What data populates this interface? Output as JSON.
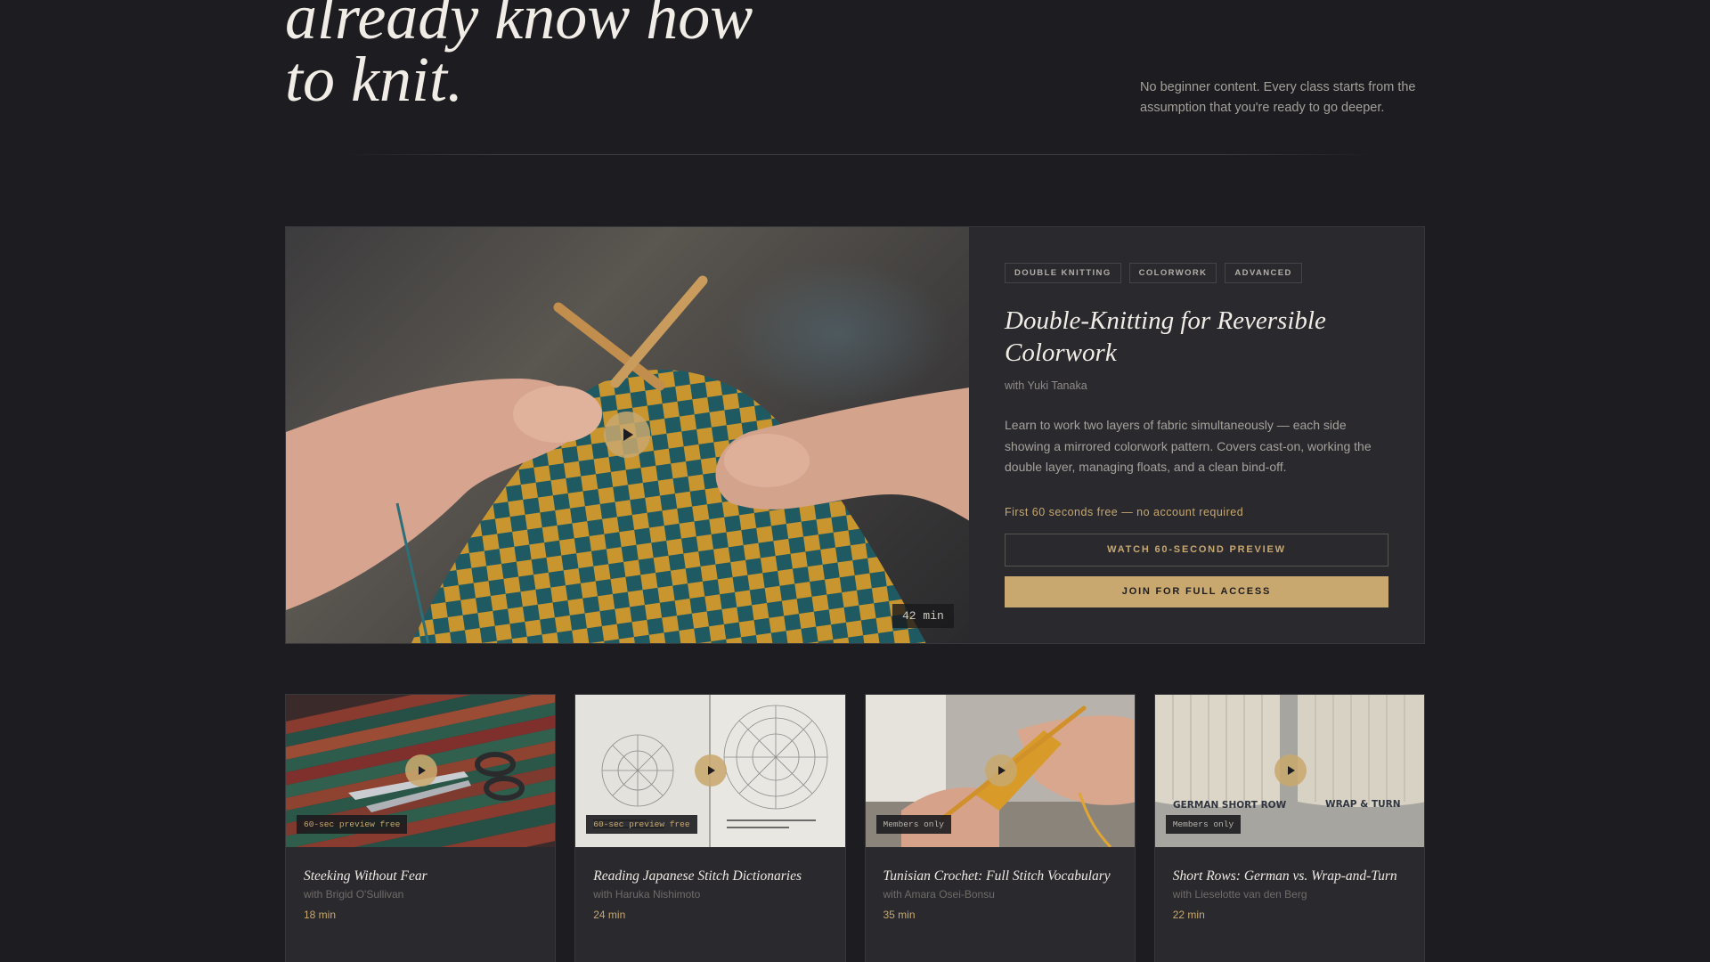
{
  "hero": {
    "title_line1": "already know how",
    "title_line2": "to knit.",
    "subtitle": "No beginner content. Every class starts from the assumption that you're ready to go deeper."
  },
  "featured": {
    "tags": [
      "DOUBLE KNITTING",
      "COLORWORK",
      "ADVANCED"
    ],
    "title": "Double-Knitting for Reversible Colorwork",
    "instructor": "with Yuki Tanaka",
    "description": "Learn to work two layers of fabric simultaneously — each side showing a mirrored colorwork pattern. Covers cast-on, working the double layer, managing floats, and a clean bind-off.",
    "duration": "42 min",
    "free_note": "First 60 seconds free — no account required",
    "preview_button": "WATCH 60-SECOND PREVIEW",
    "join_button": "JOIN FOR FULL ACCESS",
    "play_icon": "play-icon"
  },
  "cards": [
    {
      "title": "Steeking Without Fear",
      "instructor": "with Brigid O'Sullivan",
      "duration": "18 min",
      "badge": "60-sec preview free"
    },
    {
      "title": "Reading Japanese Stitch Dictionaries",
      "instructor": "with Haruka Nishimoto",
      "duration": "24 min",
      "badge": "60-sec preview free"
    },
    {
      "title": "Tunisian Crochet: Full Stitch Vocabulary",
      "instructor": "with Amara Osei-Bonsu",
      "duration": "35 min",
      "badge": "Members only"
    },
    {
      "title": "Short Rows: German vs. Wrap-and-Turn",
      "instructor": "with Lieselotte van den Berg",
      "duration": "22 min",
      "badge": "Members only",
      "image_labels": [
        "GERMAN SHORT ROW",
        "WRAP & TURN"
      ]
    }
  ],
  "colors": {
    "background": "#1d1d21",
    "panel": "#2a292e",
    "accent": "#c8a86e",
    "text": "#f1ede6"
  }
}
